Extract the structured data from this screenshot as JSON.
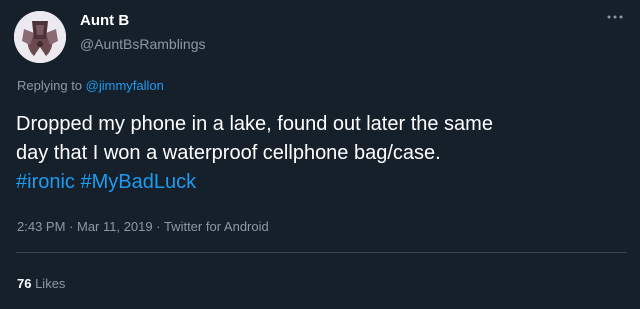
{
  "author": {
    "name": "Aunt B",
    "handle": "@AuntBsRamblings"
  },
  "reply": {
    "prefix": "Replying to ",
    "mention": "@jimmyfallon"
  },
  "tweet": {
    "text_line1": "Dropped my phone in a lake, found out later the same",
    "text_line2": "day that I won a waterproof cellphone bag/case.",
    "hashtag1": "#ironic",
    "hashtag2": "#MyBadLuck"
  },
  "meta": {
    "time": "2:43 PM",
    "sep1": " · ",
    "date": "Mar 11, 2019",
    "sep2": " · ",
    "source": "Twitter for Android"
  },
  "stats": {
    "likes_count": "76",
    "likes_label": " Likes"
  },
  "icons": {
    "menu": "more-horizontal-icon",
    "avatar": "avatar-image"
  },
  "colors": {
    "background": "#15202b",
    "link": "#1d9bf0",
    "secondary_text": "#8b98a5",
    "divider": "#38444d"
  }
}
